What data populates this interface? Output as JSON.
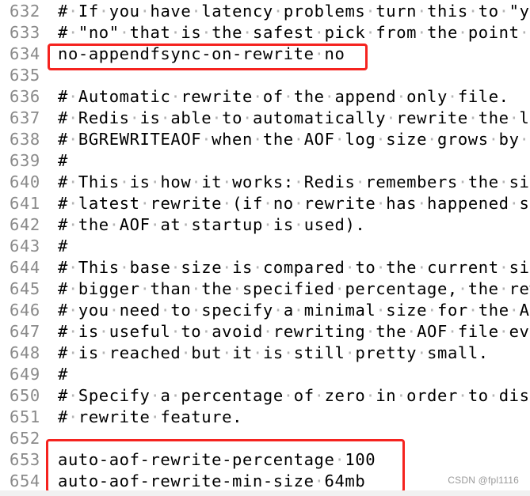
{
  "editor": {
    "whitespace_marker": "·",
    "lines": [
      {
        "number": "632",
        "text": "# If you have latency problems turn this to \"yes\". Otherwise leave it as"
      },
      {
        "number": "633",
        "text": "# \"no\" that is the safest pick from the point of view of durability."
      },
      {
        "number": "634",
        "text": "no-appendfsync-on-rewrite no"
      },
      {
        "number": "635",
        "text": ""
      },
      {
        "number": "636",
        "text": "# Automatic rewrite of the append only file."
      },
      {
        "number": "637",
        "text": "# Redis is able to automatically rewrite the log file implicitly calling"
      },
      {
        "number": "638",
        "text": "# BGREWRITEAOF when the AOF log size grows by the specified percentage."
      },
      {
        "number": "639",
        "text": "#"
      },
      {
        "number": "640",
        "text": "# This is how it works: Redis remembers the size of the AOF file after the"
      },
      {
        "number": "641",
        "text": "# latest rewrite (if no rewrite has happened since the restart, the size of"
      },
      {
        "number": "642",
        "text": "# the AOF at startup is used)."
      },
      {
        "number": "643",
        "text": "#"
      },
      {
        "number": "644",
        "text": "# This base size is compared to the current size. If the current size is"
      },
      {
        "number": "645",
        "text": "# bigger than the specified percentage, the rewrite is triggered. Also"
      },
      {
        "number": "646",
        "text": "# you need to specify a minimal size for the AOF file to be rewritten, this"
      },
      {
        "number": "647",
        "text": "# is useful to avoid rewriting the AOF file even if the percentage increase"
      },
      {
        "number": "648",
        "text": "# is reached but it is still pretty small."
      },
      {
        "number": "649",
        "text": "#"
      },
      {
        "number": "650",
        "text": "# Specify a percentage of zero in order to disable the automatic AOF"
      },
      {
        "number": "651",
        "text": "# rewrite feature."
      },
      {
        "number": "652",
        "text": ""
      },
      {
        "number": "653",
        "text": "auto-aof-rewrite-percentage 100"
      },
      {
        "number": "654",
        "text": "auto-aof-rewrite-min-size 64mb"
      }
    ]
  },
  "annotations": {
    "highlight_color": "#f5231f",
    "boxes": [
      {
        "label": "appendfsync-rewrite-highlight",
        "lines": [
          "634"
        ]
      },
      {
        "label": "auto-aof-rewrite-highlight",
        "lines": [
          "652",
          "653",
          "654"
        ]
      }
    ]
  },
  "watermark": "CSDN @fpl1116"
}
